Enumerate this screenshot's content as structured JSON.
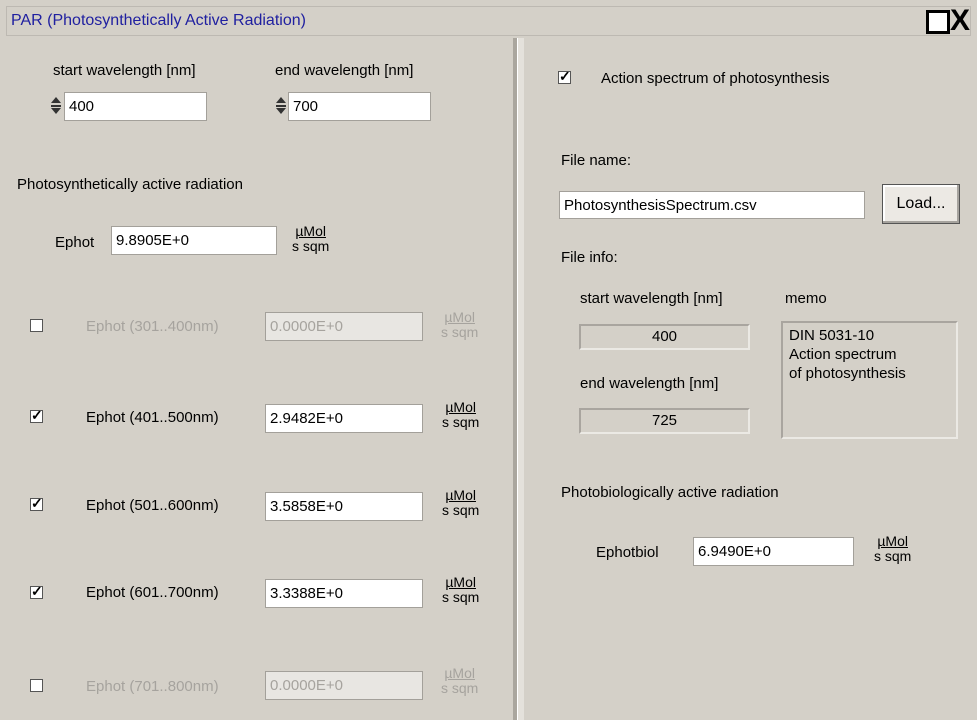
{
  "window": {
    "title": "PAR (Photosynthetically Active Radiation)"
  },
  "left": {
    "start_wavelength_label": "start wavelength [nm]",
    "end_wavelength_label": "end wavelength [nm]",
    "start_wavelength_value": "400",
    "end_wavelength_value": "700",
    "section_title": "Photosynthetically active radiation",
    "ephot_label": "Ephot",
    "ephot_value": "9.8905E+0",
    "unit_num": "µMol",
    "unit_den": "s sqm",
    "bands": [
      {
        "label": "Ephot (301..400nm)",
        "value": "0.0000E+0",
        "checked": false,
        "enabled": false
      },
      {
        "label": "Ephot (401..500nm)",
        "value": "2.9482E+0",
        "checked": true,
        "enabled": true
      },
      {
        "label": "Ephot (501..600nm)",
        "value": "3.5858E+0",
        "checked": true,
        "enabled": true
      },
      {
        "label": "Ephot (601..700nm)",
        "value": "3.3388E+0",
        "checked": true,
        "enabled": true
      },
      {
        "label": "Ephot (701..800nm)",
        "value": "0.0000E+0",
        "checked": false,
        "enabled": false
      }
    ]
  },
  "right": {
    "action_spectrum_label": "Action spectrum of photosynthesis",
    "action_spectrum_checked": true,
    "file_name_label": "File name:",
    "file_name_value": "PhotosynthesisSpectrum.csv",
    "load_button": "Load...",
    "file_info_label": "File info:",
    "start_wavelength_label": "start wavelength [nm]",
    "start_wavelength_value": "400",
    "end_wavelength_label": "end wavelength [nm]",
    "end_wavelength_value": "725",
    "memo_label": "memo",
    "memo_lines": [
      "DIN 5031-10",
      "Action spectrum",
      "of photosynthesis"
    ],
    "bio_section_title": "Photobiologically active radiation",
    "ephotbiol_label": "Ephotbiol",
    "ephotbiol_value": "6.9490E+0",
    "unit_num": "µMol",
    "unit_den": "s sqm"
  },
  "check_mark": "✓",
  "icons": [
    "maximize-icon",
    "close-icon",
    "spin-icon",
    "checkbox-icon"
  ]
}
